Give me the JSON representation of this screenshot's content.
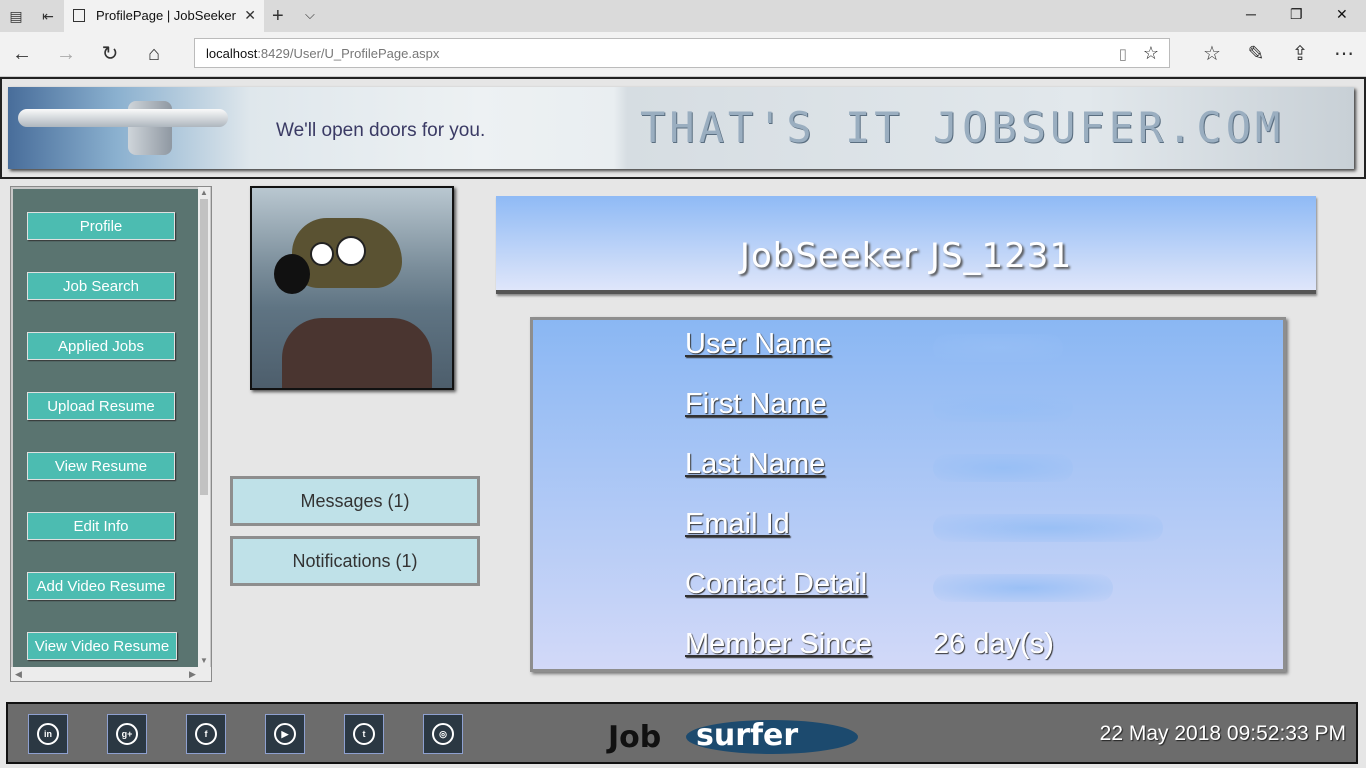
{
  "browser": {
    "tab_title": "ProfilePage | JobSeeker",
    "url_host": "localhost",
    "url_rest": ":8429/User/U_ProfilePage.aspx",
    "icons": [
      "tabs-icon",
      "back-tab-icon",
      "page-icon",
      "close-icon",
      "new-tab-icon",
      "chevron-down-icon",
      "minimize-icon",
      "restore-icon",
      "back-icon",
      "forward-icon",
      "refresh-icon",
      "home-icon",
      "reading-view-icon",
      "favorite-star-icon",
      "favorites-list-icon",
      "pen-icon",
      "share-icon",
      "more-icon"
    ]
  },
  "banner": {
    "tagline": "We'll open doors for you.",
    "brand": "THAT'S IT JOBSUFER.COM"
  },
  "sidebar": {
    "items": [
      {
        "label": "Profile"
      },
      {
        "label": "Job Search"
      },
      {
        "label": "Applied Jobs"
      },
      {
        "label": "Upload Resume"
      },
      {
        "label": "View Resume"
      },
      {
        "label": "Edit Info"
      },
      {
        "label": "Add Video Resume"
      },
      {
        "label": "View Video Resume"
      }
    ]
  },
  "actions": {
    "messages": "Messages (1)",
    "notifications": "Notifications (1)"
  },
  "profile": {
    "heading": "JobSeeker JS_1231",
    "fields": [
      {
        "label": "User Name",
        "value": ""
      },
      {
        "label": "First Name",
        "value": ""
      },
      {
        "label": "Last Name",
        "value": ""
      },
      {
        "label": "Email Id",
        "value": ""
      },
      {
        "label": "Contact Detail",
        "value": ""
      },
      {
        "label": "Member Since",
        "value": "26 day(s)"
      }
    ]
  },
  "footer": {
    "social": [
      "linkedin-icon",
      "google-plus-icon",
      "facebook-icon",
      "youtube-icon",
      "twitter-icon",
      "instagram-icon"
    ],
    "social_glyphs": [
      "in",
      "g+",
      "f",
      "▶",
      "t",
      "◎"
    ],
    "logo_left": "Job",
    "logo_right": "surfer",
    "datetime": "22 May 2018 09:52:33 PM"
  },
  "colors": {
    "sidebar_button": "#4cbcb1",
    "sidebar_bg": "#5a7470",
    "panel_gradient_top": "#8ab7f3",
    "footer_bg": "#6c6c6c"
  }
}
